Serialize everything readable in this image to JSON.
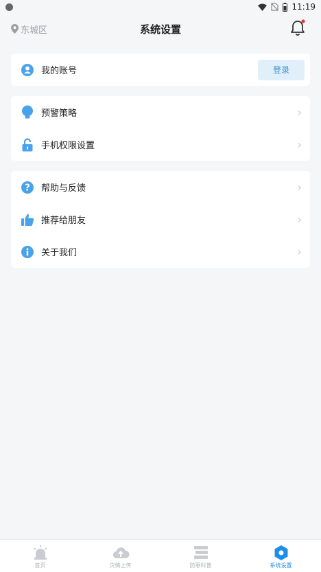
{
  "status_bar": {
    "time": "11:19"
  },
  "header": {
    "location": "东城区",
    "title": "系统设置"
  },
  "account_card": {
    "label": "我的账号",
    "login_button": "登录"
  },
  "group1": [
    {
      "label": "预警策略"
    },
    {
      "label": "手机权限设置"
    }
  ],
  "group2": [
    {
      "label": "帮助与反馈"
    },
    {
      "label": "推荐给朋友"
    },
    {
      "label": "关于我们"
    }
  ],
  "tabbar": {
    "tabs": [
      {
        "label": "首页"
      },
      {
        "label": "灾情上传"
      },
      {
        "label": "防患科普"
      },
      {
        "label": "系统设置"
      }
    ]
  },
  "colors": {
    "accent": "#1f8ee8",
    "icon_blue": "#4aa3ea",
    "notification_dot": "#e53935"
  }
}
